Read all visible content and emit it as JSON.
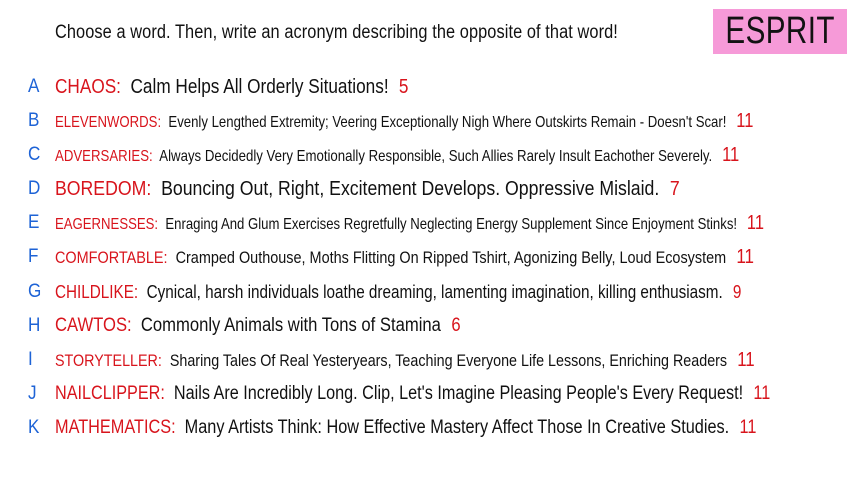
{
  "prompt": "Choose a word. Then, write an acronym describing the opposite of that word!",
  "brand": "ESPRIT",
  "colors": {
    "letter": "#1e63d6",
    "word": "#d8141c",
    "count": "#d8141c",
    "brand_bg": "#f69ad8",
    "text": "#111111"
  },
  "rows": [
    {
      "letter": "A",
      "word": "CHAOS",
      "acronym": "Calm Helps All Orderly Situations!",
      "count": "5"
    },
    {
      "letter": "B",
      "word": "ELEVENWORDS",
      "acronym": "Evenly Lengthed Extremity; Veering Exceptionally Nigh Where Outskirts Remain - Doesn't Scar!",
      "count": "11"
    },
    {
      "letter": "C",
      "word": "ADVERSARIES",
      "acronym": "Always Decidedly Very Emotionally Responsible, Such Allies Rarely Insult Eachother Severely.",
      "count": "11"
    },
    {
      "letter": "D",
      "word": "BOREDOM",
      "acronym": "Bouncing Out, Right, Excitement Develops. Oppressive Mislaid.",
      "count": "7"
    },
    {
      "letter": "E",
      "word": "EAGERNESSES",
      "acronym": "Enraging And Glum Exercises Regretfully Neglecting Energy Supplement Since Enjoyment Stinks!",
      "count": "11"
    },
    {
      "letter": "F",
      "word": "COMFORTABLE",
      "acronym": "Cramped Outhouse, Moths Flitting On Ripped Tshirt, Agonizing Belly, Loud Ecosystem",
      "count": "11"
    },
    {
      "letter": "G",
      "word": "CHILDLIKE",
      "acronym": "Cynical, harsh individuals loathe dreaming, lamenting imagination, killing enthusiasm.",
      "count": "9"
    },
    {
      "letter": "H",
      "word": "CAWTOS",
      "acronym": "Commonly Animals with Tons of Stamina",
      "count": "6"
    },
    {
      "letter": "I",
      "word": "STORYTELLER",
      "acronym": "Sharing Tales Of Real Yesteryears, Teaching Everyone Life Lessons, Enriching Readers",
      "count": "11"
    },
    {
      "letter": "J",
      "word": "NAILCLIPPER",
      "acronym": "Nails Are Incredibly Long. Clip, Let's Imagine Pleasing People's Every Request!",
      "count": "11"
    },
    {
      "letter": "K",
      "word": "MATHEMATICS",
      "acronym": "Many Artists Think: How Effective Mastery Affect Those In Creative Studies.",
      "count": "11"
    }
  ]
}
